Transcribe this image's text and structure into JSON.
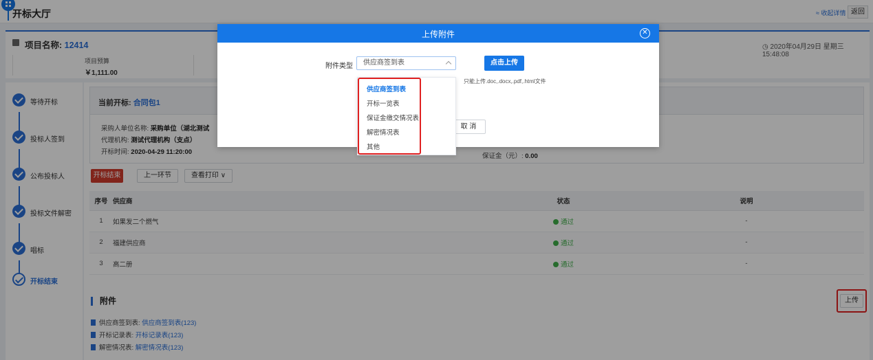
{
  "header": {
    "title": "开标大厅",
    "collapse": "≈ 收起详情",
    "back": "返回"
  },
  "project": {
    "name_label": "项目名称:",
    "name": "12414",
    "datetime": "2020年04月29日 星期三 15:48:08",
    "budget_label": "项目预算",
    "budget_value": "￥1,111.00"
  },
  "steps": [
    {
      "label": "等待开标"
    },
    {
      "label": "投标人签到"
    },
    {
      "label": "公布投标人"
    },
    {
      "label": "投标文件解密"
    },
    {
      "label": "唱标"
    },
    {
      "label": "开标结束"
    }
  ],
  "current": {
    "title": "当前开标:",
    "package": "合同包1",
    "buyer_label": "采购人单位名称:",
    "buyer": "采购单位（湖北测试",
    "agency_label": "代理机构:",
    "agency": "测试代理机构（支点）",
    "time_label": "开标时间:",
    "time": "2020-04-29 11:20:00",
    "deposit_label": "保证金（元）:",
    "deposit": "0.00"
  },
  "actions": {
    "end": "开标结束",
    "prev": "上一环节",
    "print": "查看打印 ∨"
  },
  "table": {
    "headers": {
      "no": "序号",
      "supplier": "供应商",
      "status": "状态",
      "desc": "说明"
    },
    "rows": [
      {
        "no": "1",
        "supplier": "如果发二个燃气",
        "status": "通过",
        "desc": "-"
      },
      {
        "no": "2",
        "supplier": "福建供应商",
        "status": "通过",
        "desc": "-"
      },
      {
        "no": "3",
        "supplier": "高二册",
        "status": "通过",
        "desc": "-"
      }
    ]
  },
  "attachments": {
    "title": "附件",
    "upload": "上传",
    "items": [
      {
        "label": "供应商签到表:",
        "link": "供应商签到表(123)"
      },
      {
        "label": "开标记录表:",
        "link": "开标记录表(123)"
      },
      {
        "label": "解密情况表:",
        "link": "解密情况表(123)"
      }
    ]
  },
  "modal": {
    "title": "上传附件",
    "close": "✕",
    "type_label": "附件类型",
    "selected": "供应商签到表",
    "upload_btn": "点击上传",
    "hint": "只能上传.doc,.docx,.pdf,.html文件",
    "cancel": "取 消",
    "options": [
      "供应商签到表",
      "开标一览表",
      "保证金缴交情况表",
      "解密情况表",
      "其他"
    ]
  },
  "colors": {
    "primary": "#1677e6",
    "danger": "#d03a2c",
    "success": "#3fae49",
    "highlight": "#e02020"
  }
}
